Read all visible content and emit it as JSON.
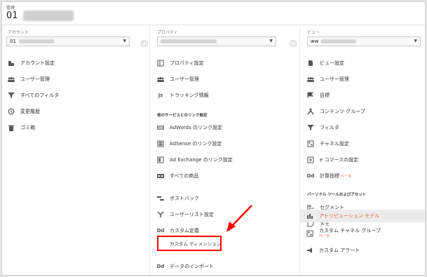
{
  "top": {
    "small_label": "管理",
    "title_prefix": "01"
  },
  "account": {
    "label": "アカウント",
    "selected_prefix": "01",
    "items": [
      {
        "icon": "building-icon",
        "label": "アカウント設定"
      },
      {
        "icon": "users-icon",
        "label": "ユーザー管理"
      },
      {
        "icon": "filter-icon",
        "label": "すべてのフィルタ"
      },
      {
        "icon": "history-icon",
        "label": "変更履歴"
      },
      {
        "icon": "trash-icon",
        "label": "ゴミ箱"
      }
    ]
  },
  "property": {
    "label": "プロパティ",
    "items_top": [
      {
        "icon": "document-icon",
        "label": "プロパティ設定"
      },
      {
        "icon": "users-icon",
        "label": "ユーザー管理"
      },
      {
        "icon": "js-icon",
        "label": "トラッキング情報"
      }
    ],
    "section_label": "他のサービスとのリンク設定",
    "link_items": [
      {
        "icon": "adwords-icon",
        "label": "AdWords のリンク設定"
      },
      {
        "icon": "adsense-icon",
        "label": "AdSense のリンク設定"
      },
      {
        "icon": "adexchange-icon",
        "label": "Ad Exchange のリンク設定"
      },
      {
        "icon": "products-icon",
        "label": "すべての商品"
      }
    ],
    "items_bottom": [
      {
        "icon": "postback-icon",
        "label": "ポストバック"
      },
      {
        "icon": "fork-icon",
        "label": "ユーザーリスト設定"
      },
      {
        "icon": "dd-icon",
        "label": "カスタム定義"
      }
    ],
    "custom_dimension_label": "カスタム ディメンション",
    "data_import": {
      "icon": "dd-icon",
      "label": "データのインポート"
    }
  },
  "view": {
    "label": "ビュー",
    "selected_prefix": "ww",
    "items": [
      {
        "icon": "document-icon",
        "label": "ビュー設定"
      },
      {
        "icon": "users-icon",
        "label": "ユーザー管理"
      },
      {
        "icon": "flag-icon",
        "label": "目標"
      },
      {
        "icon": "person-icon",
        "label": "コンテンツ グループ"
      },
      {
        "icon": "filter-icon",
        "label": "フィルタ"
      },
      {
        "icon": "channel-icon",
        "label": "チャネル設定"
      },
      {
        "icon": "cart-icon",
        "label": "e コマースの設定"
      },
      {
        "icon": "dd-icon",
        "label": "計算指標",
        "badge": "ベータ"
      }
    ],
    "section_label": "パーソナル ツールおよびアセット",
    "personal_items": [
      {
        "icon": "segment-icon",
        "label": "セグメント"
      },
      {
        "icon": "memo-icon",
        "label": "メモ"
      },
      {
        "icon": "bar-chart-icon",
        "label": "アトリビューション モデル",
        "active": true
      },
      {
        "icon": "channel-group-icon",
        "label": "カスタム チャネル グループ",
        "badge": "ベータ"
      },
      {
        "icon": "megaphone-icon",
        "label": "カスタム アラート"
      }
    ]
  },
  "colors": {
    "accent": "#e05a2e",
    "highlight_box": "#ff0000"
  }
}
